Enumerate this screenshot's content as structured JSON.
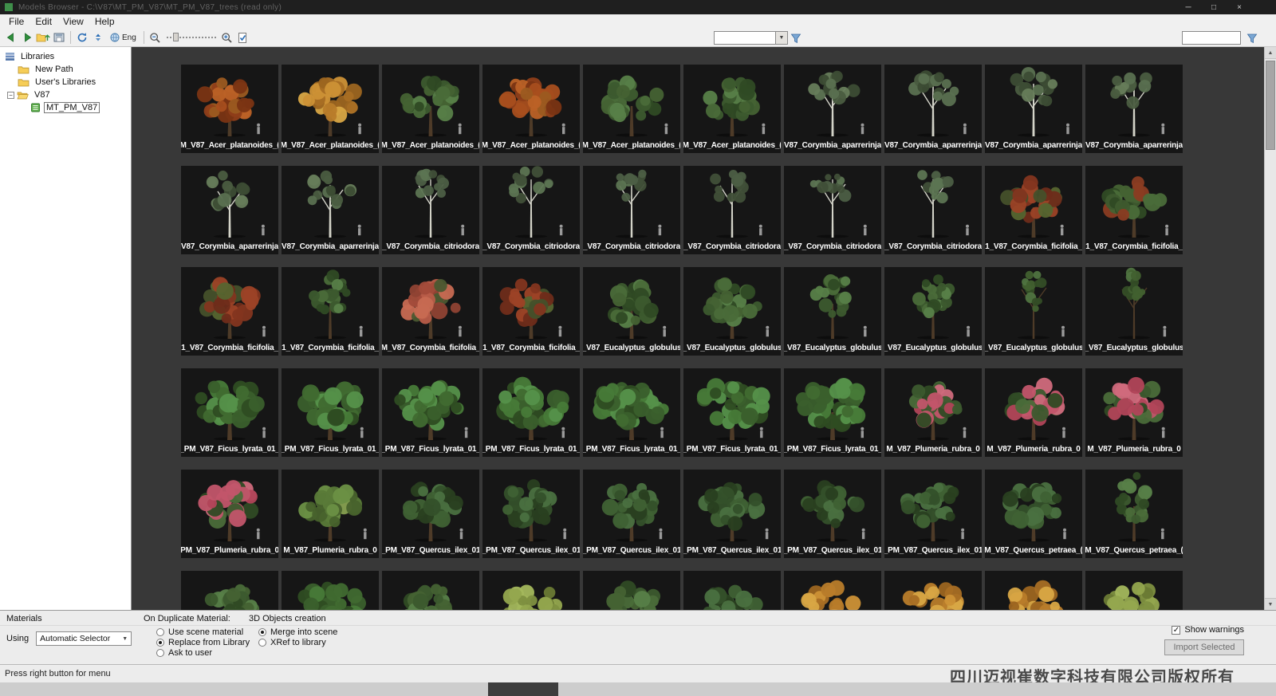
{
  "window": {
    "title": "Models Browser - C:\\V87\\MT_PM_V87\\MT_PM_V87_trees  (read only)"
  },
  "icons": {
    "minimize": "─",
    "maximize": "□",
    "close": "×",
    "triangle_up": "▲",
    "triangle_down": "▼",
    "dropdown": "▼",
    "check": "✓"
  },
  "menu": {
    "items": [
      "File",
      "Edit",
      "View",
      "Help"
    ]
  },
  "toolbar": {
    "lang_label": "Eng"
  },
  "sidebar": {
    "items": [
      {
        "label": "Libraries",
        "icon": "libraries",
        "indent": 0,
        "expander": "",
        "selected": false
      },
      {
        "label": "New Path",
        "icon": "folder",
        "indent": 1,
        "expander": "",
        "selected": false
      },
      {
        "label": "User's Libraries",
        "icon": "folder",
        "indent": 1,
        "expander": "",
        "selected": false
      },
      {
        "label": "V87",
        "icon": "folder_open",
        "indent": 1,
        "expander": "minus",
        "selected": false
      },
      {
        "label": "MT_PM_V87",
        "icon": "library",
        "indent": 2,
        "expander": "",
        "selected": true
      }
    ]
  },
  "grid": {
    "items": [
      {
        "label": "M_V87_Acer_platanoides_(",
        "type": "acer_red"
      },
      {
        "label": "M_V87_Acer_platanoides_(",
        "type": "acer_orange"
      },
      {
        "label": "M_V87_Acer_platanoides_(",
        "type": "green_round"
      },
      {
        "label": "M_V87_Acer_platanoides_(",
        "type": "acer_red"
      },
      {
        "label": "M_V87_Acer_platanoides_(",
        "type": "green_round"
      },
      {
        "label": "M_V87_Acer_platanoides_(",
        "type": "green_round"
      },
      {
        "label": "V87_Corymbia_aparrerinja",
        "type": "euc"
      },
      {
        "label": "V87_Corymbia_aparrerinja",
        "type": "euc"
      },
      {
        "label": "V87_Corymbia_aparrerinja",
        "type": "euc"
      },
      {
        "label": "V87_Corymbia_aparrerinja",
        "type": "euc"
      },
      {
        "label": "V87_Corymbia_aparrerinja",
        "type": "euc"
      },
      {
        "label": "V87_Corymbia_aparrerinja",
        "type": "euc"
      },
      {
        "label": "_V87_Corymbia_citriodora",
        "type": "whitebark"
      },
      {
        "label": "_V87_Corymbia_citriodora",
        "type": "whitebark"
      },
      {
        "label": "_V87_Corymbia_citriodora",
        "type": "whitebark"
      },
      {
        "label": "_V87_Corymbia_citriodora",
        "type": "whitebark"
      },
      {
        "label": "_V87_Corymbia_citriodora",
        "type": "whitebark"
      },
      {
        "label": "_V87_Corymbia_citriodora",
        "type": "whitebark"
      },
      {
        "label": "1_V87_Corymbia_ficifolia_",
        "type": "ficifolia_red"
      },
      {
        "label": "1_V87_Corymbia_ficifolia_",
        "type": "ficifolia_mix"
      },
      {
        "label": "1_V87_Corymbia_ficifolia_",
        "type": "ficifolia_red"
      },
      {
        "label": "1_V87_Corymbia_ficifolia_",
        "type": "green_tall"
      },
      {
        "label": "M_V87_Corymbia_ficifolia_",
        "type": "ficifolia_pink"
      },
      {
        "label": "1_V87_Corymbia_ficifolia_",
        "type": "ficifolia_red"
      },
      {
        "label": "_V87_Eucalyptus_globulus",
        "type": "green_round"
      },
      {
        "label": "_V87_Eucalyptus_globulus",
        "type": "green_round"
      },
      {
        "label": "_V87_Eucalyptus_globulus",
        "type": "green_tall"
      },
      {
        "label": "_V87_Eucalyptus_globulus",
        "type": "green_tall"
      },
      {
        "label": "_V87_Eucalyptus_globulus",
        "type": "tall_thin"
      },
      {
        "label": "_V87_Eucalyptus_globulus",
        "type": "tall_thin"
      },
      {
        "label": "_PM_V87_Ficus_lyrata_01_",
        "type": "ficus"
      },
      {
        "label": "_PM_V87_Ficus_lyrata_01_",
        "type": "ficus"
      },
      {
        "label": "_PM_V87_Ficus_lyrata_01_",
        "type": "ficus"
      },
      {
        "label": "_PM_V87_Ficus_lyrata_01_",
        "type": "ficus"
      },
      {
        "label": "_PM_V87_Ficus_lyrata_01_",
        "type": "ficus"
      },
      {
        "label": "_PM_V87_Ficus_lyrata_01_",
        "type": "ficus"
      },
      {
        "label": "_PM_V87_Ficus_lyrata_01_",
        "type": "ficus"
      },
      {
        "label": "M_V87_Plumeria_rubra_0",
        "type": "plumeria"
      },
      {
        "label": "M_V87_Plumeria_rubra_0",
        "type": "plumeria"
      },
      {
        "label": "M_V87_Plumeria_rubra_0",
        "type": "plumeria"
      },
      {
        "label": "PM_V87_Plumeria_rubra_0",
        "type": "plumeria"
      },
      {
        "label": "M_V87_Plumeria_rubra_0",
        "type": "plumeria_green"
      },
      {
        "label": "_PM_V87_Quercus_ilex_01",
        "type": "quercus"
      },
      {
        "label": "_PM_V87_Quercus_ilex_01",
        "type": "quercus"
      },
      {
        "label": "_PM_V87_Quercus_ilex_01",
        "type": "quercus"
      },
      {
        "label": "_PM_V87_Quercus_ilex_01",
        "type": "quercus"
      },
      {
        "label": "_PM_V87_Quercus_ilex_01",
        "type": "quercus"
      },
      {
        "label": "_PM_V87_Quercus_ilex_01",
        "type": "quercus"
      },
      {
        "label": "M_V87_Quercus_petraea_(",
        "type": "quercus"
      },
      {
        "label": "M_V87_Quercus_petraea_(",
        "type": "green_tall"
      },
      {
        "label": "",
        "type": "green_round"
      },
      {
        "label": "",
        "type": "ficus"
      },
      {
        "label": "",
        "type": "green_round"
      },
      {
        "label": "",
        "type": "yellow_green"
      },
      {
        "label": "",
        "type": "green_round"
      },
      {
        "label": "",
        "type": "quercus"
      },
      {
        "label": "",
        "type": "acer_orange"
      },
      {
        "label": "",
        "type": "acer_orange"
      },
      {
        "label": "",
        "type": "acer_orange"
      },
      {
        "label": "",
        "type": "yellow_green"
      }
    ]
  },
  "bottom": {
    "materials_heading": "Materials",
    "using_label": "Using",
    "using_value": "Automatic Selector",
    "dup_heading": "On Duplicate Material:",
    "dup_options": [
      {
        "label": "Use scene material",
        "selected": false
      },
      {
        "label": "Replace from Library",
        "selected": true
      },
      {
        "label": "Ask to user",
        "selected": false
      }
    ],
    "creation_heading": "3D Objects creation",
    "creation_options": [
      {
        "label": "Merge into scene",
        "selected": true
      },
      {
        "label": "XRef to library",
        "selected": false
      }
    ],
    "show_warnings": {
      "label": "Show warnings",
      "checked": true
    },
    "import_button": "Import Selected"
  },
  "status": {
    "hint": "Press right button for menu",
    "watermark": "四川迈视崔数字科技有限公司版权所有"
  }
}
